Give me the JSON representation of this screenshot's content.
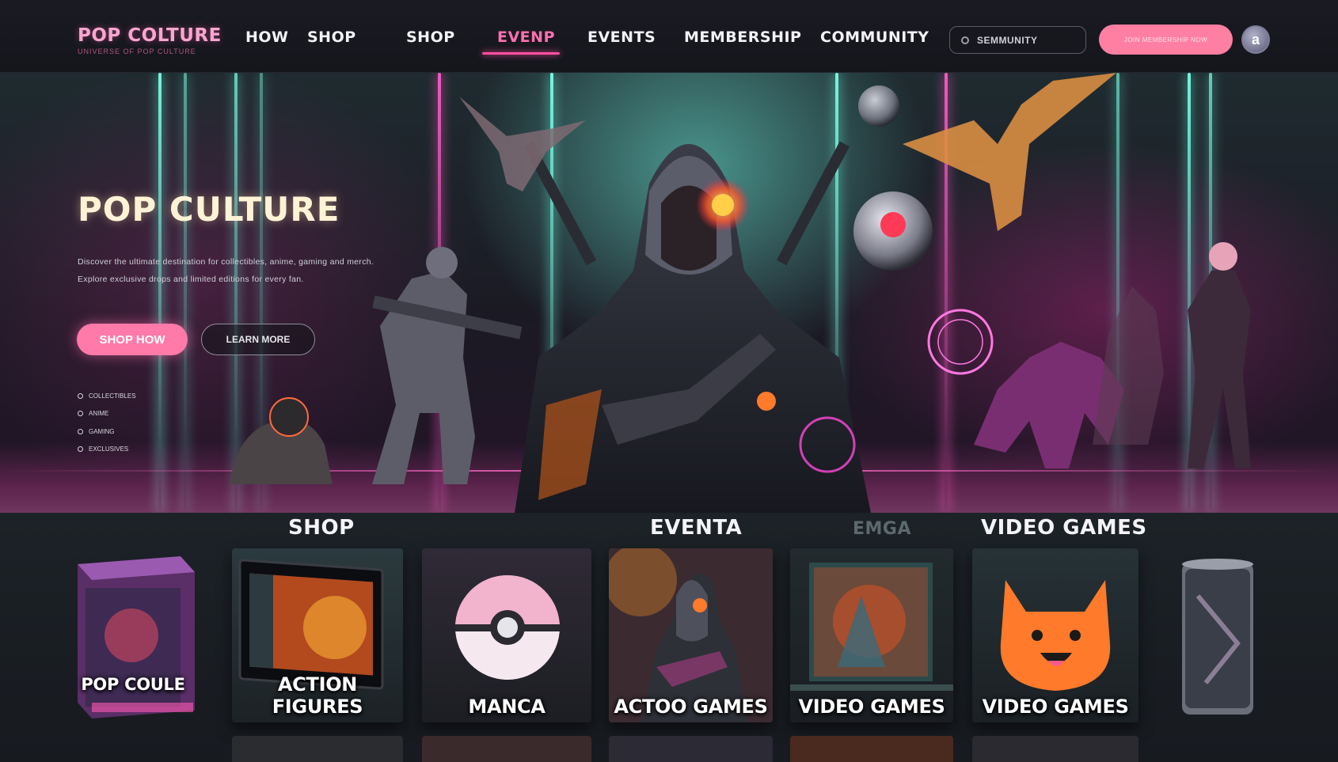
{
  "nav": {
    "logo_title": "POP COLTURE",
    "logo_subtitle": "UNIVERSE OF POP CULTURE",
    "links": [
      "HOW",
      "SHOP",
      "SHOP",
      "EVENP",
      "EVENTS",
      "MEMBERSHIP",
      "COMMUNITY"
    ],
    "active_link": "EVENP",
    "search_placeholder": "SEMMUNITY",
    "cta_label": "JOIN MEMBERSHIP NOW",
    "avatar_initial": "a"
  },
  "hero": {
    "title": "POP CULTURE",
    "description": "Discover the ultimate destination for collectibles, anime, gaming and merch. Explore exclusive drops and limited editions for every fan.",
    "primary_button": "SHOP HOW",
    "secondary_button": "LEARN MORE",
    "feature_list": [
      "COLLECTIBLES",
      "ANIME",
      "GAMING",
      "EXCLUSIVES"
    ]
  },
  "categories": {
    "headings": [
      "SHOP",
      "EVENTA",
      "EMGA",
      "VIDEO GAMES"
    ],
    "tiles": [
      {
        "label": "POP COULE",
        "art": "box"
      },
      {
        "label": "ACTION FIGURES",
        "art": "screen"
      },
      {
        "label": "MANCA",
        "art": "ball"
      },
      {
        "label": "ACTOO GAMES",
        "art": "ninja"
      },
      {
        "label": "VIDEO GAMES",
        "art": "comic"
      },
      {
        "label": "VIDEO GAMES",
        "art": "plush"
      },
      {
        "label": "",
        "art": "can"
      }
    ]
  },
  "colors": {
    "accent_pink": "#ff7aa8",
    "neon_teal": "#6ff2dc",
    "neon_magenta": "#ff5ac8",
    "background": "#121318"
  }
}
